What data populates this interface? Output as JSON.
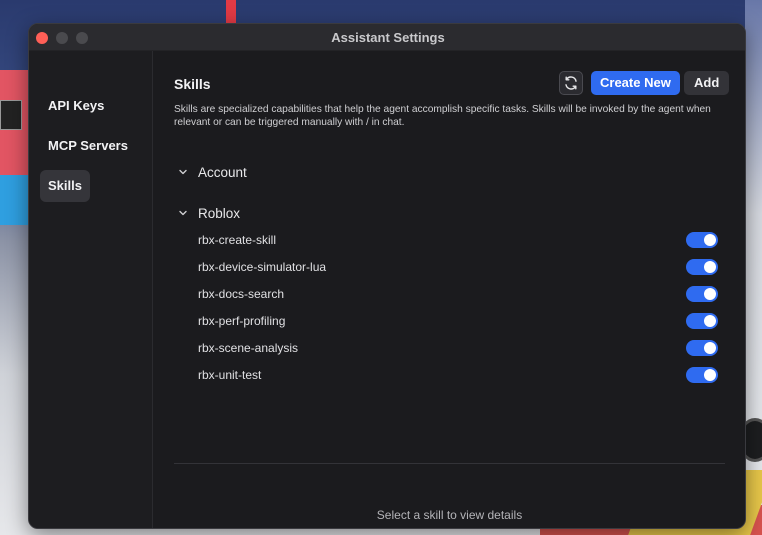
{
  "window": {
    "title": "Assistant Settings"
  },
  "sidebar": {
    "items": [
      {
        "label": "API Keys",
        "active": false
      },
      {
        "label": "MCP Servers",
        "active": false
      },
      {
        "label": "Skills",
        "active": true
      }
    ]
  },
  "main": {
    "title": "Skills",
    "create_label": "Create New",
    "add_label": "Add",
    "description": "Skills are specialized capabilities that help the agent accomplish specific tasks. Skills will be invoked by the agent when relevant or can be triggered manually with / in chat.",
    "groups": [
      {
        "name": "Account",
        "expanded": true,
        "skills": []
      },
      {
        "name": "Roblox",
        "expanded": true,
        "skills": [
          {
            "name": "rbx-create-skill",
            "enabled": true
          },
          {
            "name": "rbx-device-simulator-lua",
            "enabled": true
          },
          {
            "name": "rbx-docs-search",
            "enabled": true
          },
          {
            "name": "rbx-perf-profiling",
            "enabled": true
          },
          {
            "name": "rbx-scene-analysis",
            "enabled": true
          },
          {
            "name": "rbx-unit-test",
            "enabled": true
          }
        ]
      }
    ],
    "detail_placeholder": "Select a skill to view details"
  },
  "colors": {
    "accent": "#2f6bf0",
    "window_bg": "#1b1b1e",
    "close_button": "#ff5f57"
  },
  "icons": {
    "refresh": "refresh-icon",
    "chevron": "chevron-down-icon"
  }
}
